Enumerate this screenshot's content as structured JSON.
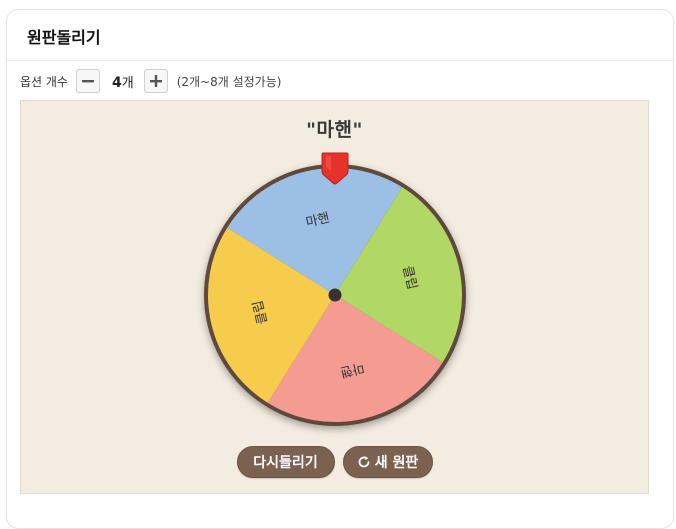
{
  "header": {
    "title": "원판돌리기"
  },
  "options": {
    "label": "옵션 개수",
    "count": "4",
    "count_unit": "개",
    "range_note": "(2개~8개 설정가능)"
  },
  "result": {
    "text": "\"마핸\""
  },
  "wheel": {
    "segments": [
      {
        "label": "마핸",
        "color": "#9bbfe5"
      },
      {
        "label": "클립",
        "color": "#b1d765"
      },
      {
        "label": "마핸",
        "color": "#f59c92"
      },
      {
        "label": "클립",
        "color": "#f6cc4d"
      }
    ],
    "rim_color": "#5e4a3e",
    "pointer_color": "#e5332a"
  },
  "buttons": {
    "spin_again": "다시돌리기",
    "new_wheel": "새 원판"
  },
  "colors": {
    "stage_bg": "#f3ece1",
    "button_bg": "#7b6150"
  }
}
